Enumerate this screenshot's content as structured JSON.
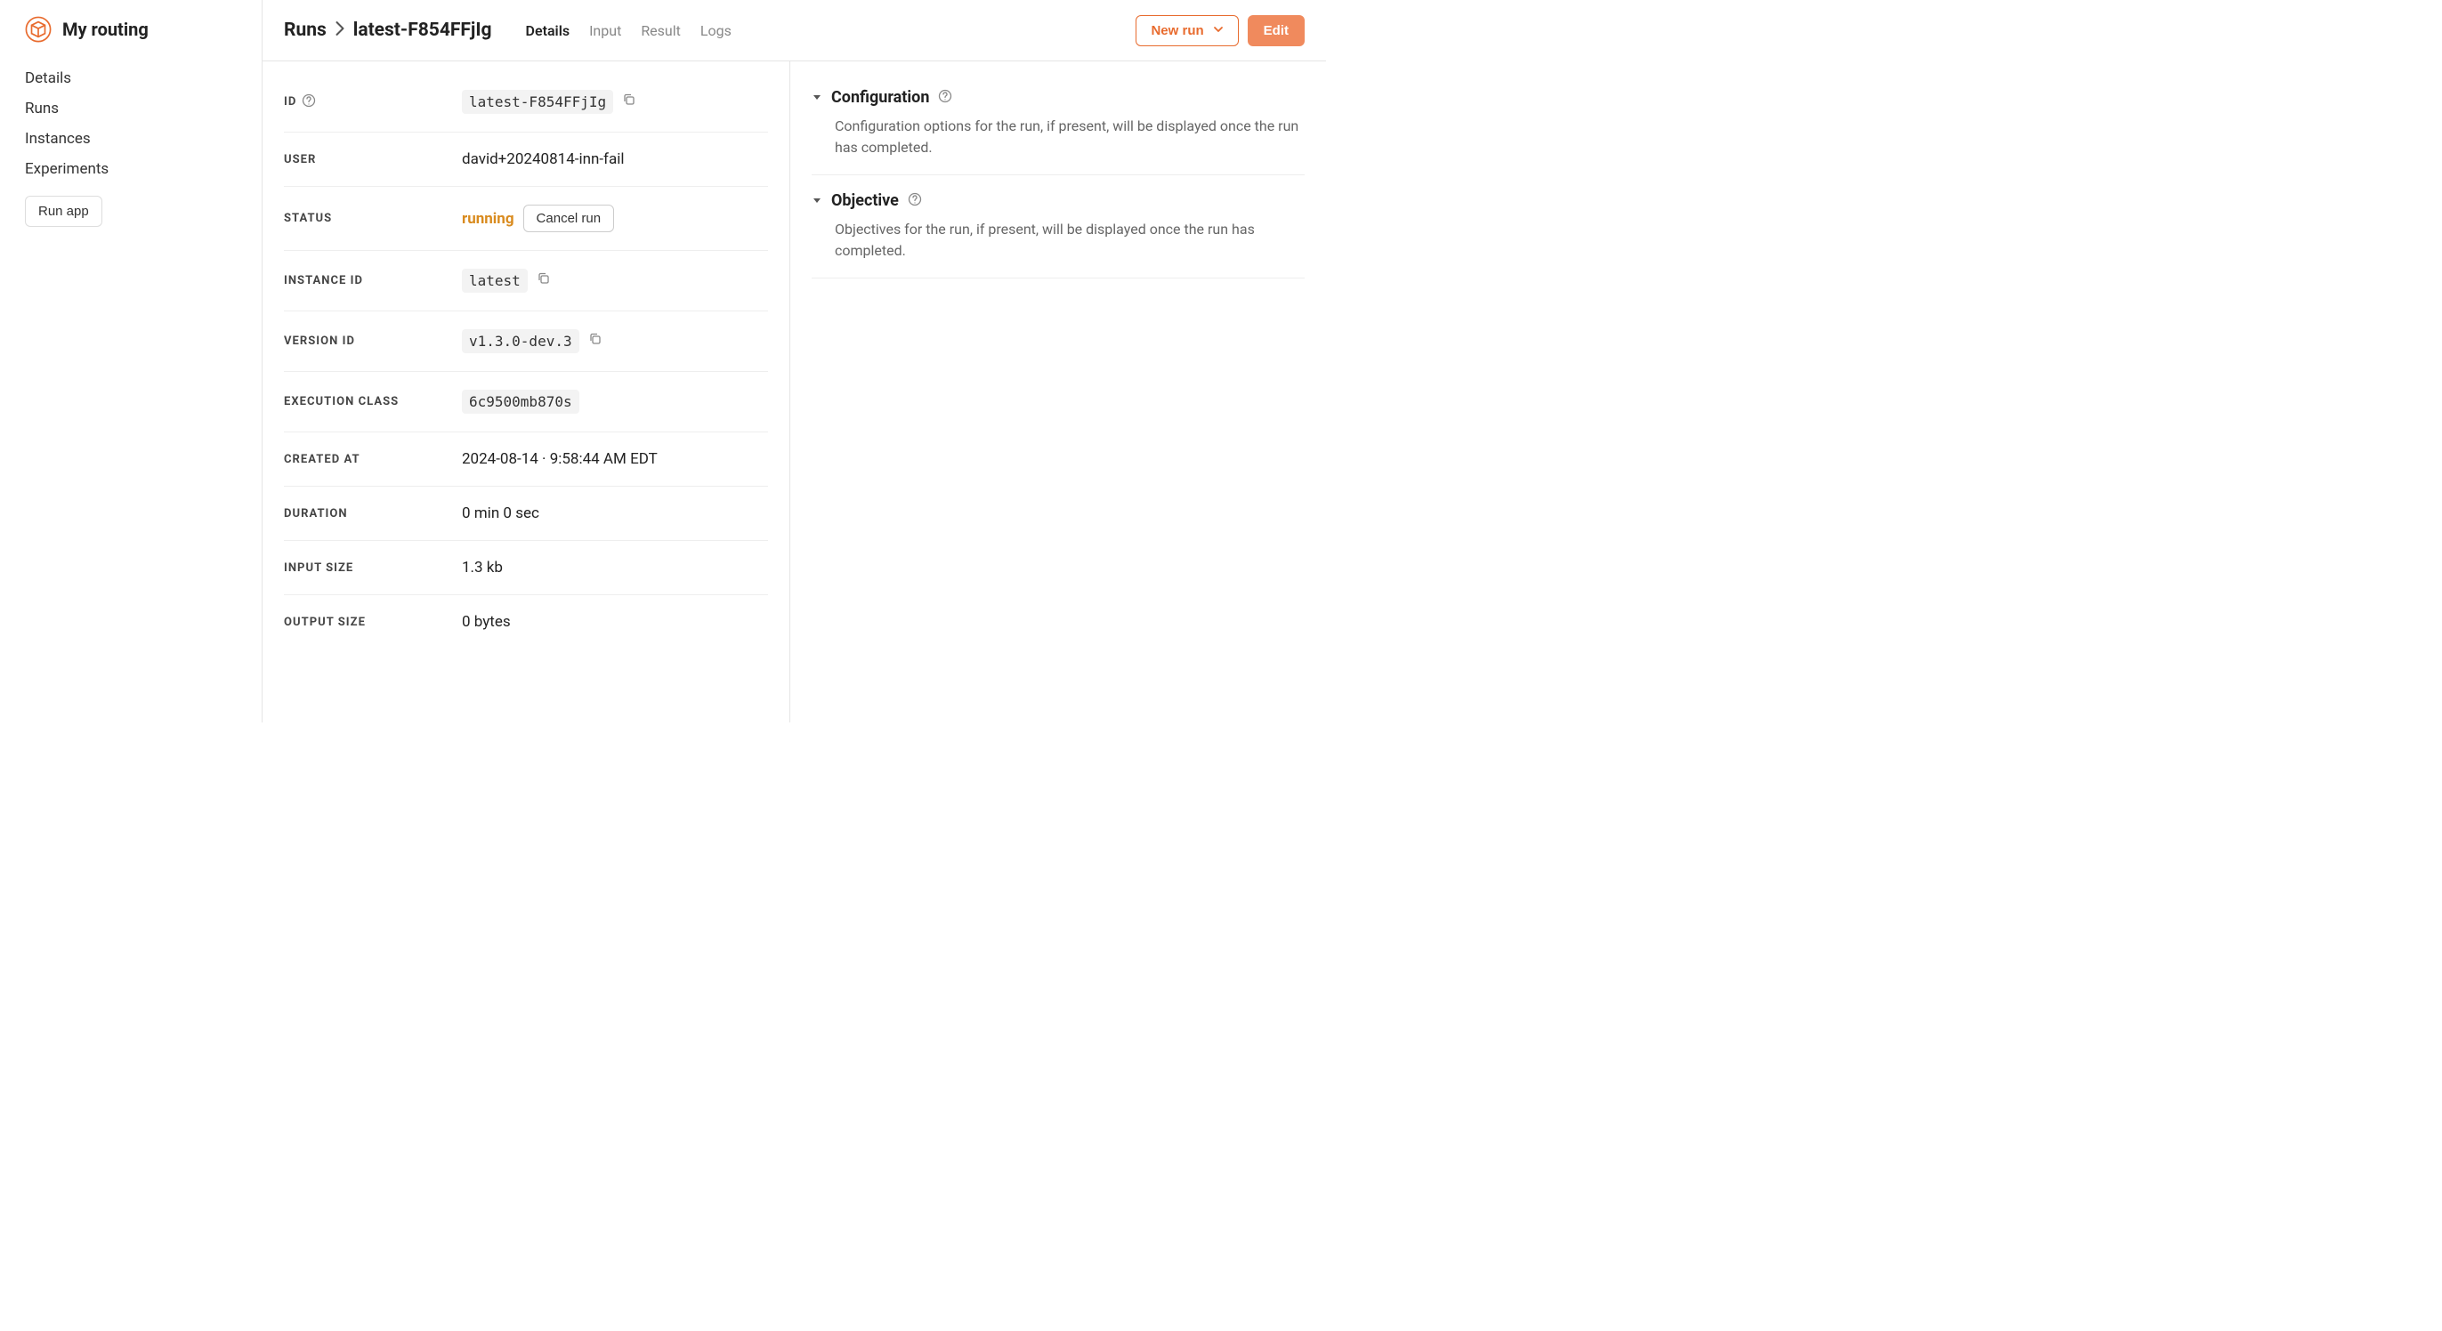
{
  "sidebar": {
    "title": "My routing",
    "nav": [
      "Details",
      "Runs",
      "Instances",
      "Experiments"
    ],
    "run_app_label": "Run app"
  },
  "breadcrumb": {
    "parent": "Runs",
    "current": "latest-F854FFjIg"
  },
  "tabs": [
    {
      "label": "Details",
      "active": true
    },
    {
      "label": "Input",
      "active": false
    },
    {
      "label": "Result",
      "active": false
    },
    {
      "label": "Logs",
      "active": false
    }
  ],
  "actions": {
    "new_run_label": "New run",
    "edit_label": "Edit"
  },
  "details": {
    "id_label": "ID",
    "id_value": "latest-F854FFjIg",
    "user_label": "USER",
    "user_value": "david+20240814-inn-fail",
    "status_label": "STATUS",
    "status_value": "running",
    "cancel_label": "Cancel run",
    "instance_id_label": "INSTANCE ID",
    "instance_id_value": "latest",
    "version_id_label": "VERSION ID",
    "version_id_value": "v1.3.0-dev.3",
    "execution_class_label": "EXECUTION CLASS",
    "execution_class_value": "6c9500mb870s",
    "created_at_label": "CREATED AT",
    "created_at_value": "2024-08-14 · 9:58:44 AM EDT",
    "duration_label": "DURATION",
    "duration_value": "0 min 0 sec",
    "input_size_label": "INPUT SIZE",
    "input_size_value": "1.3 kb",
    "output_size_label": "OUTPUT SIZE",
    "output_size_value": "0 bytes"
  },
  "panels": {
    "configuration_title": "Configuration",
    "configuration_body": "Configuration options for the run, if present, will be displayed once the run has completed.",
    "objective_title": "Objective",
    "objective_body": "Objectives for the run, if present, will be displayed once the run has completed."
  }
}
